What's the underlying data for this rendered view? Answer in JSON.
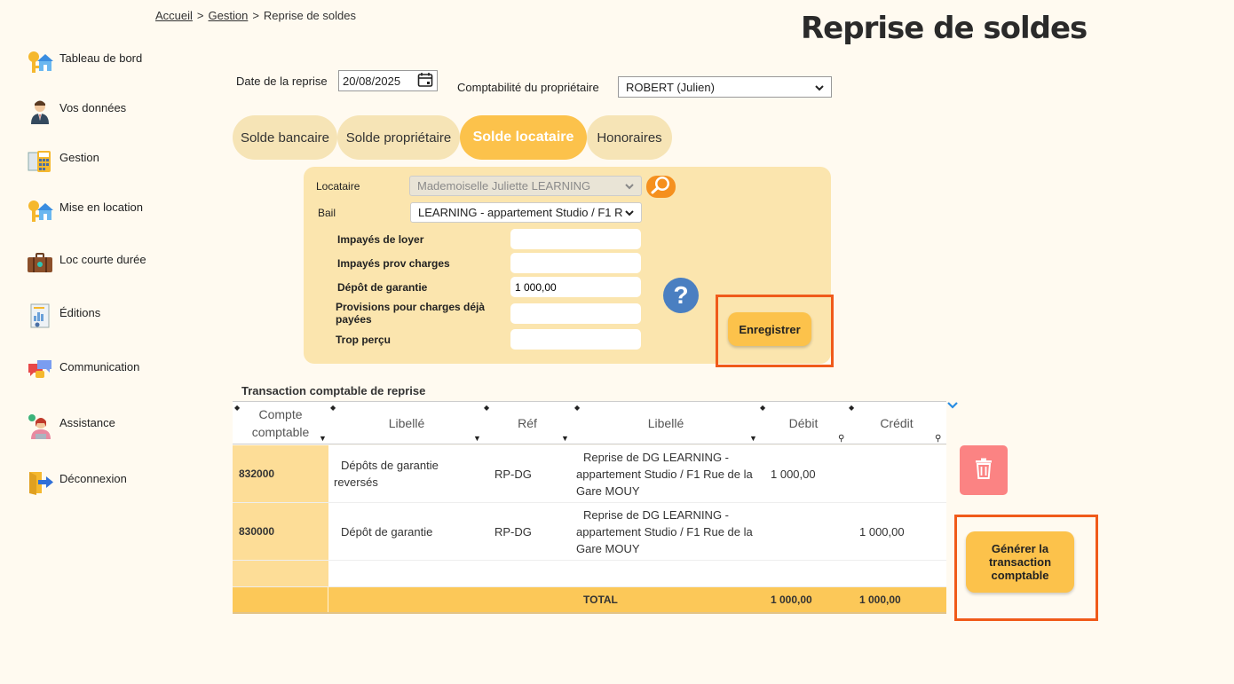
{
  "breadcrumb": {
    "home": "Accueil",
    "gestion": "Gestion",
    "current": "Reprise de soldes",
    "sep": ">"
  },
  "page_title": "Reprise de soldes",
  "sidebar": {
    "items": [
      {
        "label": "Tableau de bord",
        "icon": "house-key-icon"
      },
      {
        "label": "Vos données",
        "icon": "user-icon"
      },
      {
        "label": "Gestion",
        "icon": "calculator-icon"
      },
      {
        "label": "Mise en location",
        "icon": "house-key-icon"
      },
      {
        "label": "Loc courte durée",
        "icon": "suitcase-icon"
      },
      {
        "label": "Éditions",
        "icon": "report-icon"
      },
      {
        "label": "Communication",
        "icon": "chat-icon"
      },
      {
        "label": "Assistance",
        "icon": "support-agent-icon"
      },
      {
        "label": "Déconnexion",
        "icon": "logout-icon"
      }
    ]
  },
  "controls": {
    "date_label": "Date de la reprise",
    "date_value": "20/08/2025",
    "compta_label": "Comptabilité du propriétaire",
    "compta_value": "ROBERT (Julien)"
  },
  "tabs": [
    {
      "label": "Solde bancaire",
      "active": false
    },
    {
      "label": "Solde propriétaire",
      "active": false
    },
    {
      "label": "Solde locataire",
      "active": true
    },
    {
      "label": "Honoraires",
      "active": false
    }
  ],
  "form": {
    "locataire_label": "Locataire",
    "locataire_value": "Mademoiselle Juliette LEARNING",
    "bail_label": "Bail",
    "bail_value": "LEARNING - appartement Studio / F1 R",
    "impayes_loyer_label": "Impayés de loyer",
    "impayes_loyer_value": "",
    "impayes_prov_label": "Impayés prov charges",
    "impayes_prov_value": "",
    "depot_label": "Dépôt de garantie",
    "depot_value": "1 000,00",
    "provisions_label": "Provisions pour charges déjà payées",
    "provisions_value": "",
    "trop_percu_label": "Trop perçu",
    "trop_percu_value": "",
    "help_symbol": "?",
    "save_label": "Enregistrer"
  },
  "table": {
    "title": "Transaction comptable de reprise",
    "headers": [
      "Compte comptable",
      "Libellé",
      "Réf",
      "Libellé",
      "Débit",
      "Crédit"
    ],
    "rows": [
      {
        "compte": "832000",
        "libelle1": "Dépôts de garantie reversés",
        "ref": "RP-DG",
        "libelle2": "Reprise de DG LEARNING - appartement Studio / F1 Rue de la Gare MOUY",
        "debit": "1 000,00",
        "credit": ""
      },
      {
        "compte": "830000",
        "libelle1": "Dépôt de garantie",
        "ref": "RP-DG",
        "libelle2": "Reprise de DG LEARNING - appartement Studio / F1 Rue de la Gare MOUY",
        "debit": "",
        "credit": "1 000,00"
      }
    ],
    "total_label": "TOTAL",
    "total_debit": "1 000,00",
    "total_credit": "1 000,00"
  },
  "generate_label": "Générer la transaction comptable",
  "colors": {
    "accent": "#fcc24b",
    "panel": "#fbe5ae",
    "highlight": "#f05a1a",
    "trash": "#fb8383"
  }
}
